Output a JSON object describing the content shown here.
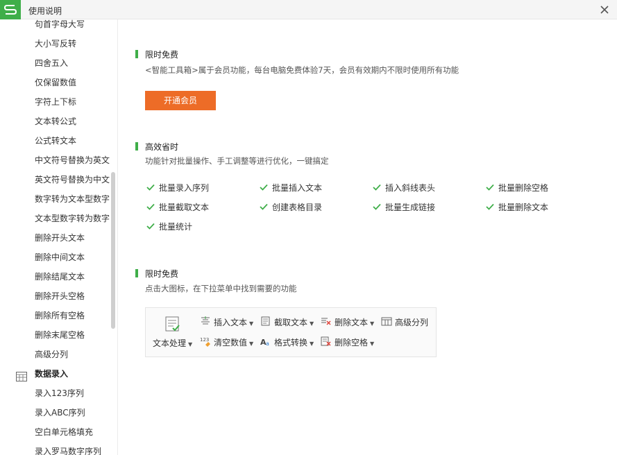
{
  "window": {
    "title": "使用说明"
  },
  "sidebar": {
    "items": [
      {
        "label": "句首字母大写",
        "group": false
      },
      {
        "label": "大小写反转",
        "group": false
      },
      {
        "label": "四舍五入",
        "group": false
      },
      {
        "label": "仅保留数值",
        "group": false
      },
      {
        "label": "字符上下标",
        "group": false
      },
      {
        "label": "文本转公式",
        "group": false
      },
      {
        "label": "公式转文本",
        "group": false
      },
      {
        "label": "中文符号替换为英文",
        "group": false
      },
      {
        "label": "英文符号替换为中文",
        "group": false
      },
      {
        "label": "数字转为文本型数字",
        "group": false
      },
      {
        "label": "文本型数字转为数字",
        "group": false
      },
      {
        "label": "删除开头文本",
        "group": false
      },
      {
        "label": "删除中间文本",
        "group": false
      },
      {
        "label": "删除结尾文本",
        "group": false
      },
      {
        "label": "删除开头空格",
        "group": false
      },
      {
        "label": "删除所有空格",
        "group": false
      },
      {
        "label": "删除末尾空格",
        "group": false
      },
      {
        "label": "高级分列",
        "group": false
      },
      {
        "label": "数据录入",
        "group": true
      },
      {
        "label": "录入123序列",
        "group": false
      },
      {
        "label": "录入ABC序列",
        "group": false
      },
      {
        "label": "空白单元格填充",
        "group": false
      },
      {
        "label": "录入罗马数字序列",
        "group": false
      }
    ]
  },
  "sections": {
    "free": {
      "title": "限时免费",
      "desc": "<智能工具箱>属于会员功能，每台电脑免费体验7天，会员有效期内不限时使用所有功能",
      "button": "开通会员"
    },
    "efficient": {
      "title": "高效省时",
      "desc": "功能针对批量操作、手工调整等进行优化，一键搞定",
      "features": [
        "批量录入序列",
        "批量插入文本",
        "插入斜线表头",
        "批量删除空格",
        "批量截取文本",
        "创建表格目录",
        "批量生成链接",
        "批量删除文本",
        "批量统计"
      ]
    },
    "usage": {
      "title": "限时免费",
      "desc": "点击大图标，在下拉菜单中找到需要的功能",
      "toolbar": {
        "big_label": "文本处理",
        "row1": [
          "插入文本",
          "截取文本",
          "删除文本",
          "高级分列"
        ],
        "row2": [
          "清空数值",
          "格式转换",
          "删除空格"
        ]
      }
    }
  },
  "colors": {
    "accent": "#3fae49",
    "button": "#ed6c27"
  }
}
